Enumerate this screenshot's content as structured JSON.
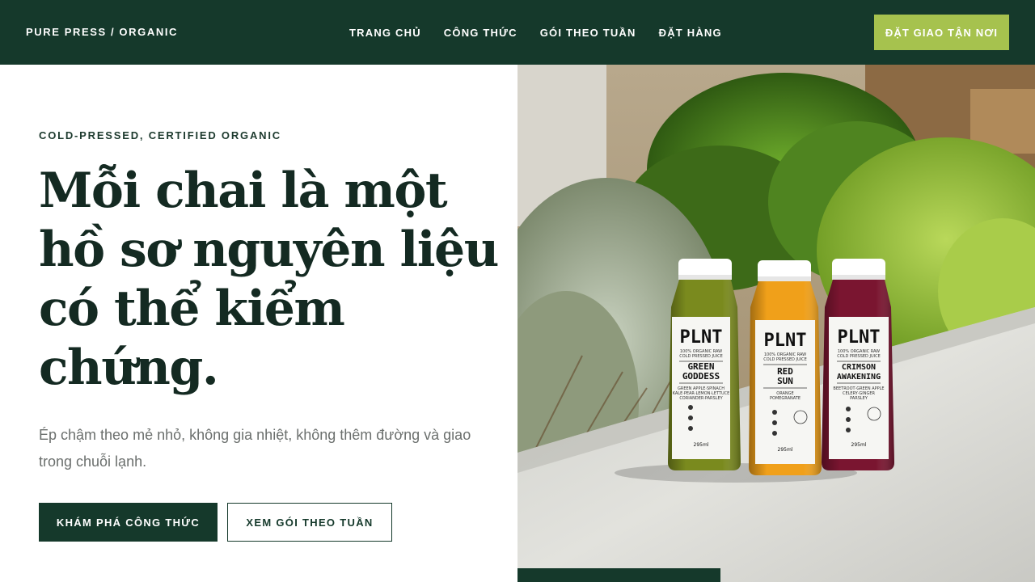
{
  "header": {
    "brand": "PURE PRESS / ORGANIC",
    "nav": [
      "TRANG CHỦ",
      "CÔNG THỨC",
      "GÓI THEO TUẦN",
      "ĐẶT HÀNG"
    ],
    "cta": "ĐẶT GIAO TẬN NƠI"
  },
  "hero": {
    "eyebrow": "COLD-PRESSED, CERTIFIED ORGANIC",
    "headline": "Mỗi chai là một hồ sơ nguyên liệu có thể kiểm chứng.",
    "lede": "Ép chậm theo mẻ nhỏ, không gia nhiệt, không thêm đường và giao trong chuỗi lạnh.",
    "primary_button": "KHÁM PHÁ CÔNG THỨC",
    "secondary_button": "XEM GÓI THEO TUẦN"
  },
  "photo": {
    "bottles": [
      {
        "brand": "PLNT",
        "subtitle1": "100% ORGANIC RAW",
        "subtitle2": "COLD PRESSED JUICE",
        "name1": "GREEN",
        "name2": "GODDESS",
        "ingredients1": "GREEN APPLE·SPINACH",
        "ingredients2": "KALE·PEAR·LEMON·LETTUCE",
        "ingredients3": "CORIANDER·PARSLEY",
        "volume": "295ml",
        "color": "#7a8a1e"
      },
      {
        "brand": "PLNT",
        "subtitle1": "100% ORGANIC RAW",
        "subtitle2": "COLD PRESSED JUICE",
        "name1": "RED",
        "name2": "SUN",
        "ingredients1": "ORANGE",
        "ingredients2": "POMEGRANATE",
        "ingredients3": "",
        "volume": "295ml",
        "color": "#f0a01a"
      },
      {
        "brand": "PLNT",
        "subtitle1": "100% ORGANIC RAW",
        "subtitle2": "COLD PRESSED JUICE",
        "name1": "CRIMSON",
        "name2": "AWAKENING",
        "ingredients1": "BEETROOT·GREEN APPLE",
        "ingredients2": "CELERY·GINGER",
        "ingredients3": "PARSLEY",
        "volume": "295ml",
        "color": "#7a1530"
      }
    ]
  },
  "colors": {
    "header_bg": "#15392b",
    "accent": "#a6c24e",
    "headline": "#142a22",
    "body_text": "#6b6f6d"
  }
}
